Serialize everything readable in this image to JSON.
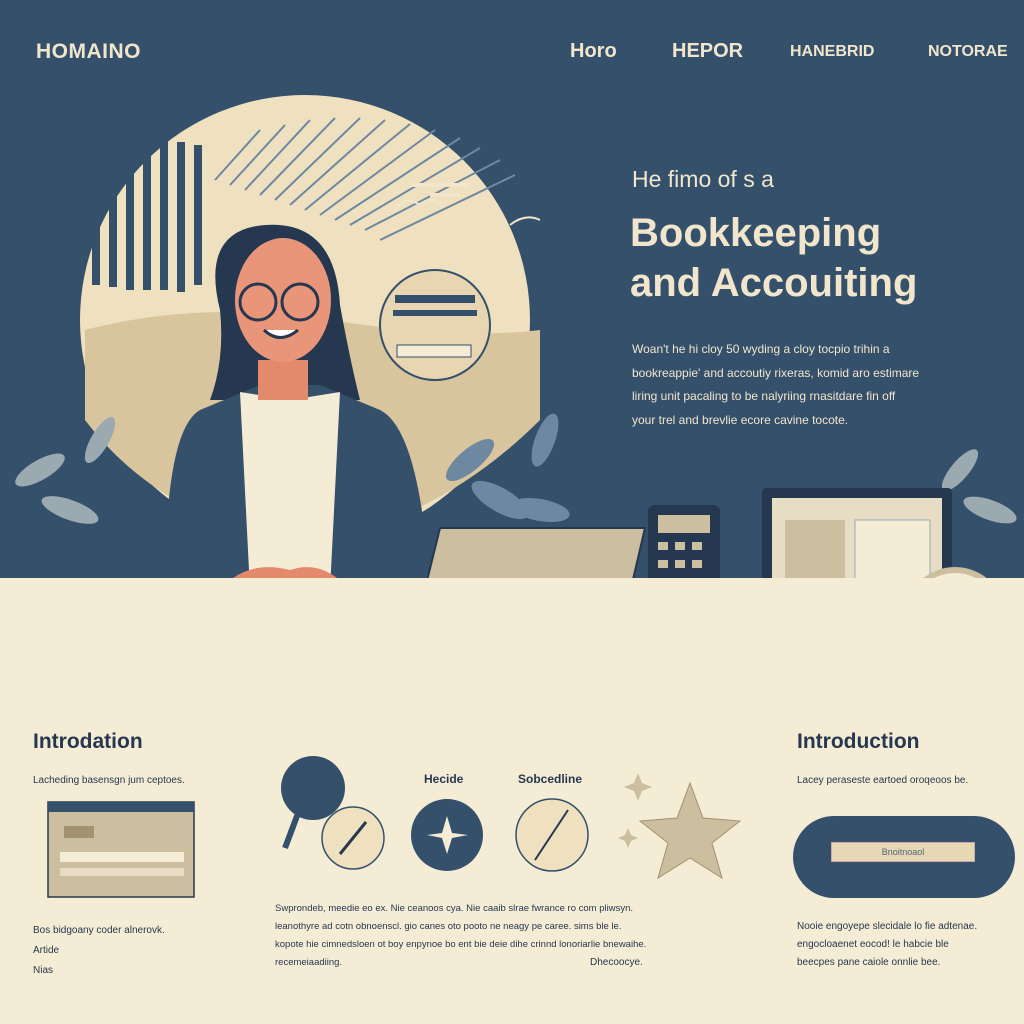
{
  "nav": {
    "brand": "HOMAINO",
    "items": [
      {
        "label": "Horo"
      },
      {
        "label": "HEPOR"
      },
      {
        "label": "HANEBRID"
      },
      {
        "label": "NOTORAE"
      }
    ]
  },
  "hero": {
    "kicker": "He fimo of s a",
    "title_line1": "Bookkeeping",
    "title_line2": "and Accouiting",
    "lead": [
      "Woan't he hi cloy 50 wyding a cloy tocpio trihin a",
      "bookreappie' and accoutiy rixeras, komid aro estimare",
      "liring unit pacaling to be nalyriing rnasitdare fin off",
      "your trel and brevlie ecore cavine tocote."
    ]
  },
  "left": {
    "heading": "Introdation",
    "subtitle": "Lacheding basensgn jum ceptoes.",
    "lines": [
      "Bos bidgoany coder alnerovk.",
      "Artide",
      "Nias"
    ]
  },
  "middle": {
    "headline": "Hecide",
    "subheadline": "Sobcedline",
    "paragraph": [
      "Swprondeb, meedie eo ex. Nie ceanoos cya. Nie caaib slrae fwrance ro com pliwsyn.",
      "leanothyre ad cotn obnoenscl. gio canes oto pooto ne neagy pe caree. sims ble le.",
      "kopote hie cimnedsloen ot boy enpynoe bo ent bie deie dihe crinnd lonoriarlie bnewaihe.",
      "recemeiaadiing."
    ],
    "footnote": "Dhecoocye."
  },
  "right": {
    "heading": "Introduction",
    "subtitle": "Lacey peraseste eartoed oroqeoos be.",
    "button_label": "Bnoitnoaol",
    "paragraph": [
      "Nooie engoyepe slecidale lo fie adtenae.",
      "engocloaenet eocod! le habcie ble",
      "beecpes pane caiole onnlie bee."
    ]
  },
  "colors": {
    "navy": "#34506b",
    "cream": "#f5ecd6",
    "tan": "#c9b58e",
    "ink": "#26384f"
  }
}
